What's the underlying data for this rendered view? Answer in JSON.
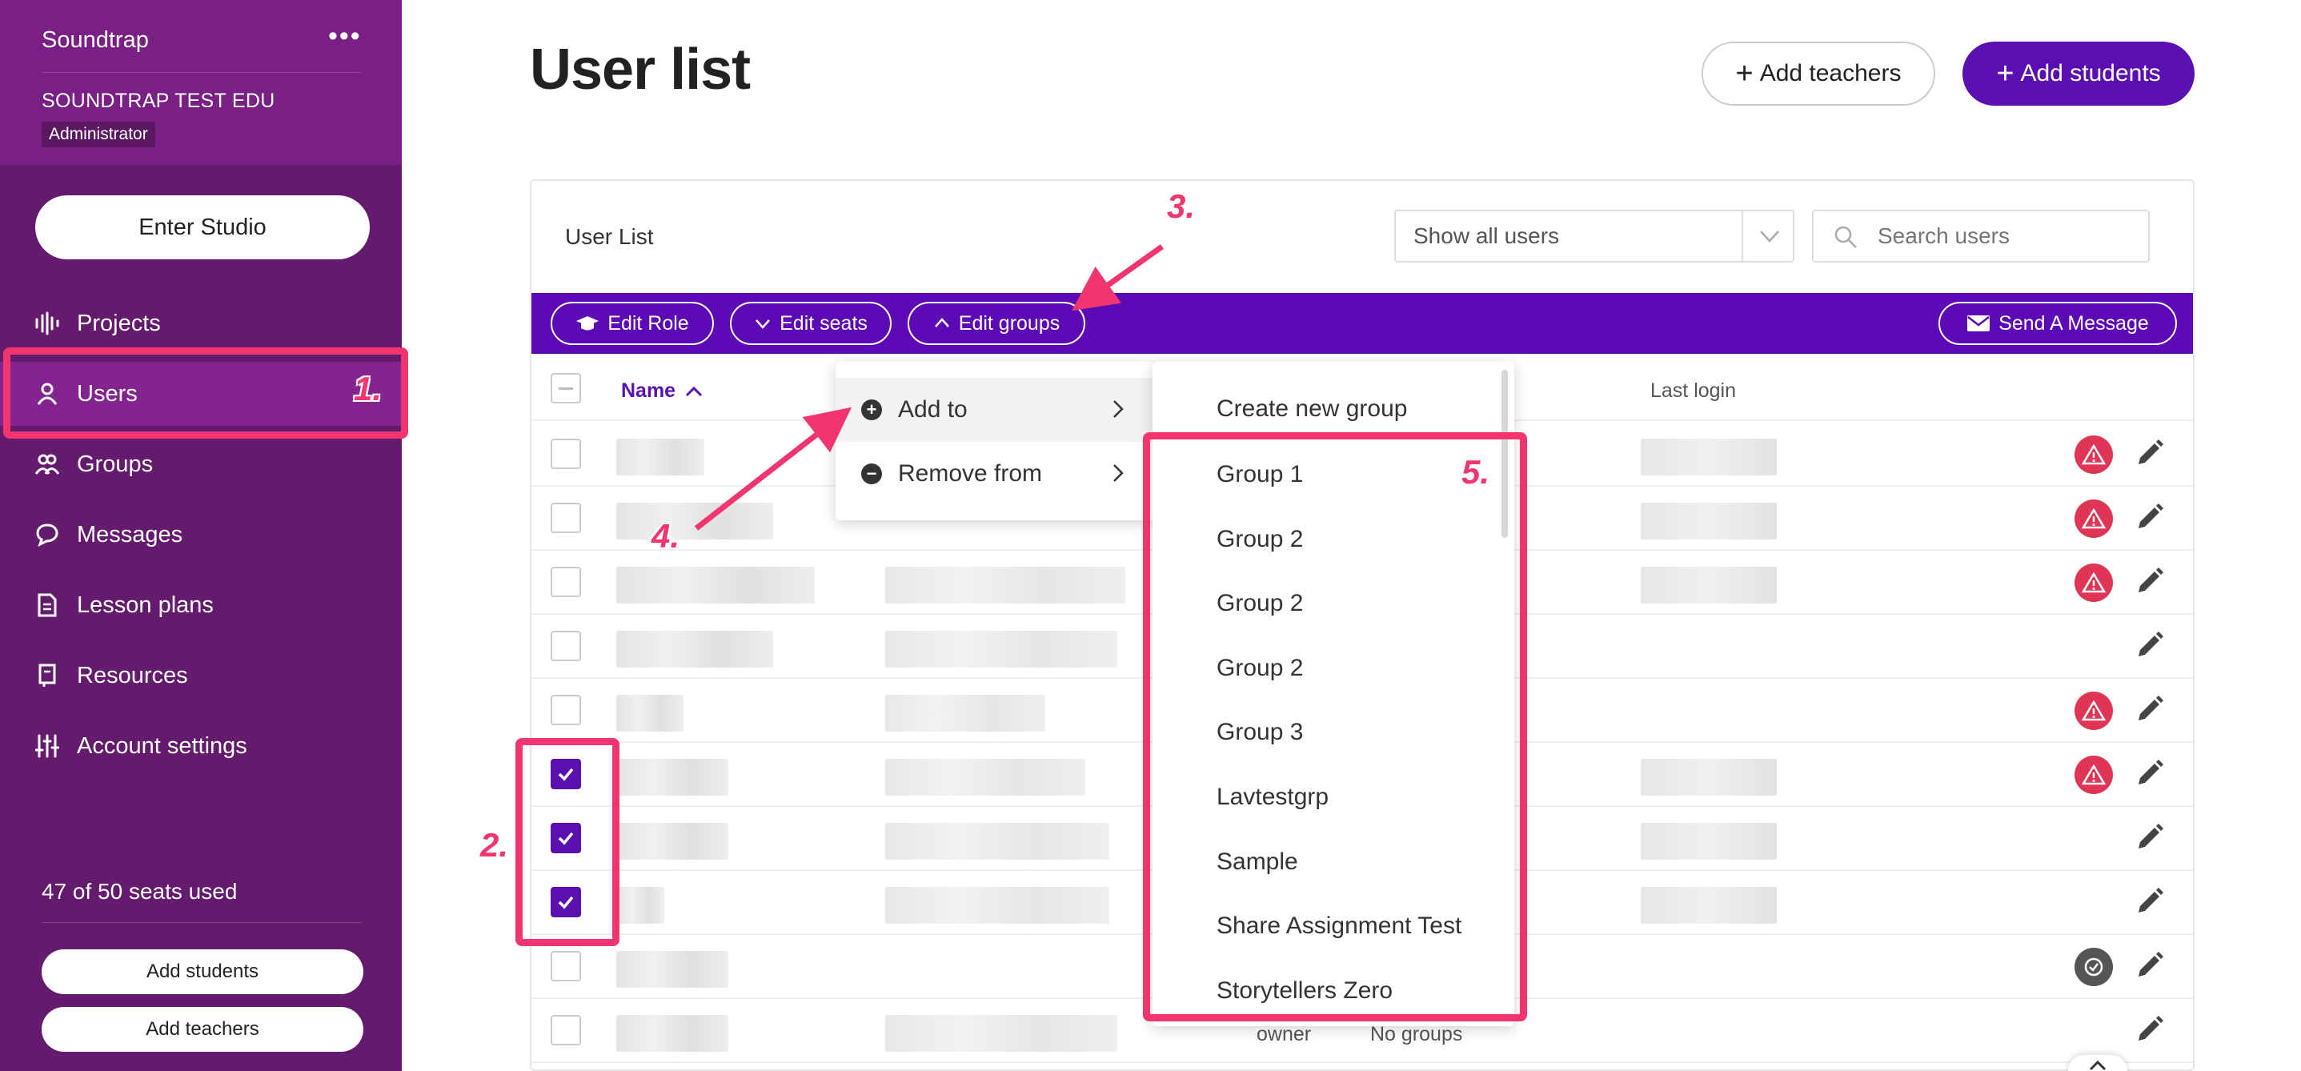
{
  "sidebar": {
    "brand": "Soundtrap",
    "more": "•••",
    "org": "SOUNDTRAP TEST EDU",
    "role": "Administrator",
    "enter_studio": "Enter Studio",
    "nav": [
      {
        "label": "Projects",
        "icon": "waveform-icon"
      },
      {
        "label": "Users",
        "icon": "user-icon",
        "active": true
      },
      {
        "label": "Groups",
        "icon": "users-group-icon"
      },
      {
        "label": "Messages",
        "icon": "chat-bubble-icon"
      },
      {
        "label": "Lesson plans",
        "icon": "document-icon"
      },
      {
        "label": "Resources",
        "icon": "bookmark-icon"
      },
      {
        "label": "Account settings",
        "icon": "sliders-icon"
      }
    ],
    "seats": "47 of 50 seats used",
    "add_students": "Add students",
    "add_teachers": "Add teachers"
  },
  "header": {
    "title": "User list",
    "add_teachers": "Add teachers",
    "add_students": "Add students"
  },
  "card": {
    "title": "User List",
    "filter_value": "Show all users",
    "search_placeholder": "Search users"
  },
  "toolbar": {
    "edit_role": "Edit Role",
    "edit_seats": "Edit seats",
    "edit_groups": "Edit groups",
    "send_message": "Send A Message"
  },
  "table": {
    "col_name": "Name",
    "col_login": "Last login",
    "last_row_role": "owner",
    "last_row_groups": "No groups"
  },
  "menu": {
    "add_to": "Add to",
    "remove_from": "Remove from"
  },
  "groups_menu": {
    "create": "Create new group",
    "items": [
      "Group 1",
      "Group 2",
      "Group 2",
      "Group 2",
      "Group 3",
      "Lavtestgrp",
      "Sample",
      "Share Assignment Test",
      "Storytellers Zero"
    ]
  },
  "annotations": {
    "n1": "1.",
    "n2": "2.",
    "n3": "3.",
    "n4": "4.",
    "n5": "5.",
    "color": "#f2356f"
  },
  "colors": {
    "sidebar": "#651b6d",
    "primary": "#5a0fb0",
    "warning": "#e03455"
  }
}
